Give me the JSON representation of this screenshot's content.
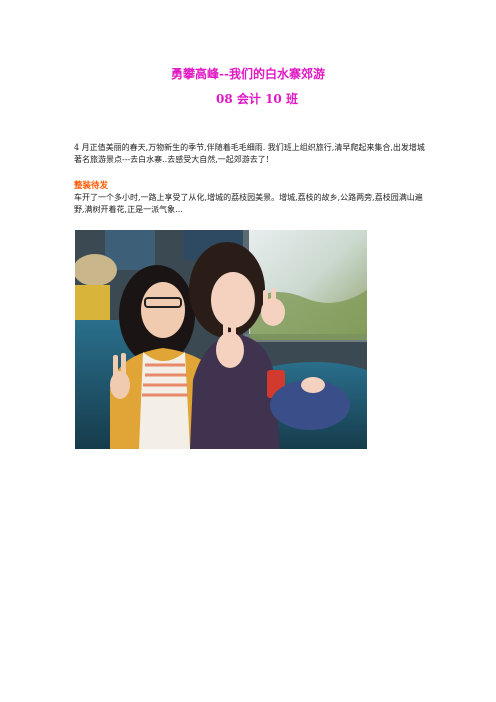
{
  "document": {
    "title": "勇攀高峰--我们的白水寨郊游",
    "subtitle": "08 会计 10 班",
    "intro": "4 月正值美丽的春天,万物新生的季节,伴随着毛毛细雨. 我们班上组织旅行,清早爬起来集合,出发增城著名旅游景点---去白水寨..去感受大自然,一起郊游去了!",
    "section": {
      "heading": "整装待发",
      "text": "车开了一个多小时,一路上享受了从化,增城的荔枝园美景。增城,荔枝的故乡,公路两旁,荔枝园满山遍野,满树开着花,正是一派气象..."
    },
    "photo": {
      "subject": "two students on a bus making peace signs"
    }
  },
  "colors": {
    "title": "#e019c4",
    "heading": "#ff5a00",
    "text": "#222222"
  }
}
